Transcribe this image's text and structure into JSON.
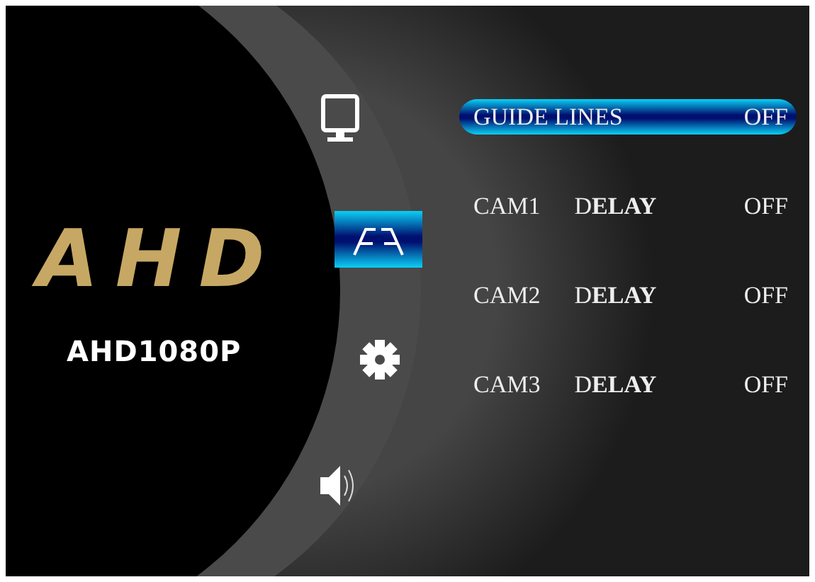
{
  "brand": {
    "logo": "AHD",
    "model": "AHD1080P"
  },
  "side_menu": [
    {
      "kind": "monitor",
      "selected": false
    },
    {
      "kind": "guides",
      "selected": true
    },
    {
      "kind": "settings",
      "selected": false
    },
    {
      "kind": "sound",
      "selected": false
    }
  ],
  "settings": [
    {
      "label": "GUIDE LINES",
      "value": "OFF",
      "selected": true
    },
    {
      "label": "CAM1",
      "label_2": "D**ELAY**",
      "value": "OFF",
      "selected": false
    },
    {
      "label": "CAM2",
      "label_2": "D**ELAY**",
      "value": "OFF",
      "selected": false
    },
    {
      "label": "CAM3",
      "label_2": "D**ELAY**",
      "value": "OFF",
      "selected": false
    }
  ]
}
